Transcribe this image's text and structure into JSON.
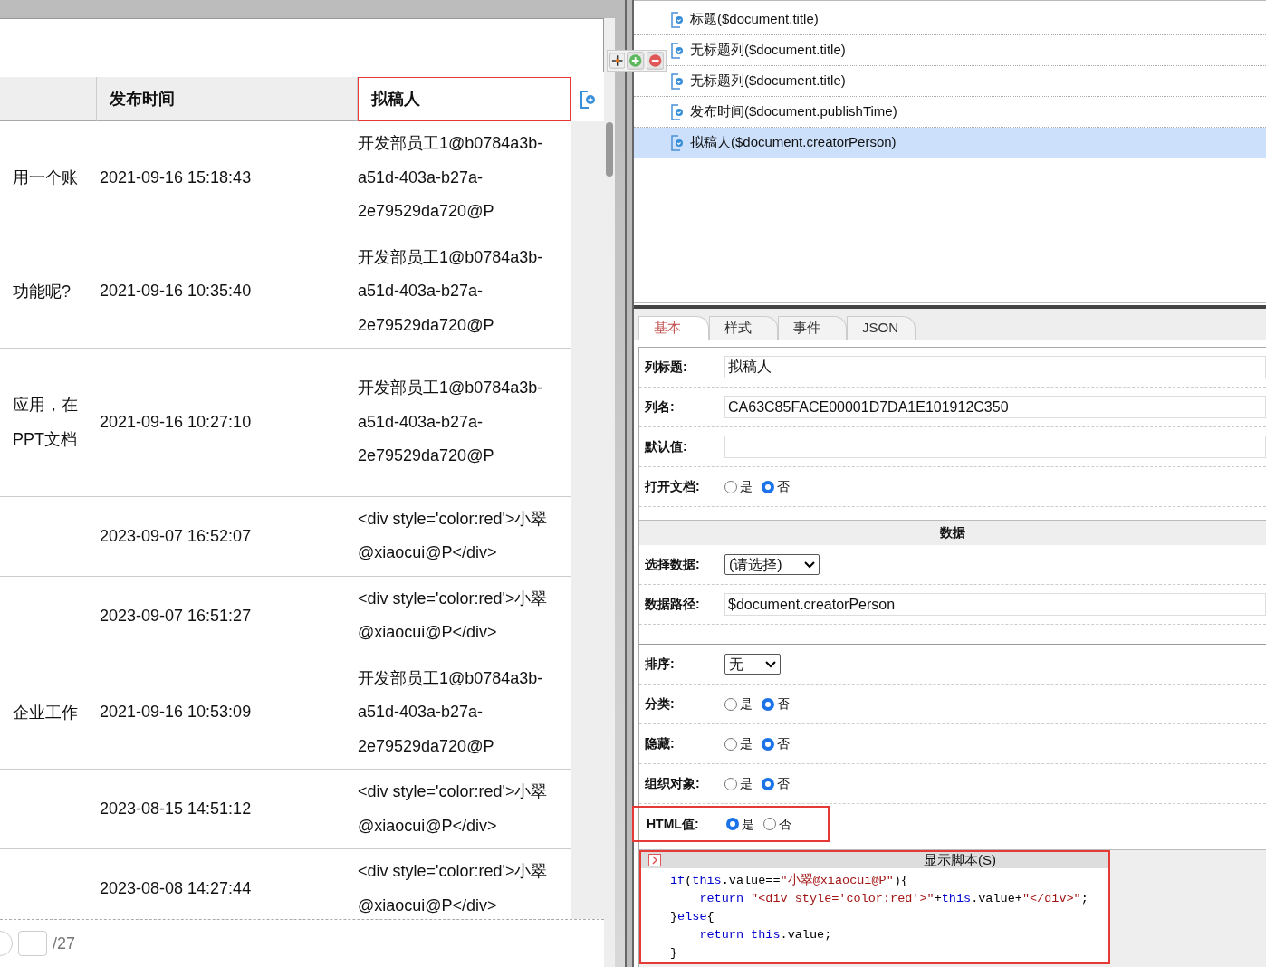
{
  "table": {
    "columns": [
      {
        "selected": false
      },
      {
        "label": "发布时间",
        "selected": false
      },
      {
        "label": "拟稿人",
        "selected": true
      }
    ],
    "rows": [
      {
        "column_1": "用一个账",
        "time": "2021-09-16 15:18:43",
        "author": "开发部员工1@b0784a3b-\na51d-403a-b27a-\n2e79529da720@P"
      },
      {
        "column_1": "功能呢?",
        "time": "2021-09-16 10:35:40",
        "author": "开发部员工1@b0784a3b-\na51d-403a-b27a-\n2e79529da720@P"
      },
      {
        "column_1": "应用，在\nPPT文档",
        "time": "2021-09-16 10:27:10",
        "author": "开发部员工1@b0784a3b-\na51d-403a-b27a-\n2e79529da720@P"
      },
      {
        "time": "2023-09-07 16:52:07",
        "author": "<div style='color:red'>小翠\n@xiaocui@P</div>"
      },
      {
        "time": "2023-09-07 16:51:27",
        "author": "<div style='color:red'>小翠\n@xiaocui@P</div>"
      },
      {
        "column_1": "企业工作",
        "time": "2021-09-16 10:53:09",
        "author": "开发部员工1@b0784a3b-\na51d-403a-b27a-\n2e79529da720@P"
      },
      {
        "time": "2023-08-15 14:51:12",
        "author": "<div style='color:red'>小翠\n@xiaocui@P</div>"
      },
      {
        "time": "2023-08-08 14:27:44",
        "author": "<div style='color:red'>小翠\n@xiaocui@P</div>"
      }
    ]
  },
  "pagination": {
    "total": "/27"
  },
  "fields": [
    {
      "label": "标题($document.title)",
      "selected": false
    },
    {
      "label": "无标题列($document.title)",
      "selected": false
    },
    {
      "label": "无标题列($document.title)",
      "selected": false
    },
    {
      "label": "发布时间($document.publishTime)",
      "selected": false
    },
    {
      "label": "拟稿人($document.creatorPerson)",
      "selected": true
    }
  ],
  "tabs": [
    {
      "label": "基本",
      "selected": true
    },
    {
      "label": "样式",
      "selected": false
    },
    {
      "label": "事件",
      "selected": false
    },
    {
      "label": "JSON",
      "selected": false
    }
  ],
  "form": [
    {
      "kind": "text",
      "label": "列标题:",
      "value": "拟稿人"
    },
    {
      "kind": "text",
      "label": "列名:",
      "value": "CA63C85FACE00001D7DA1E101912C350"
    },
    {
      "kind": "text",
      "label": "默认值:"
    },
    {
      "kind": "radio",
      "label": "打开文档:",
      "options": [
        {
          "label": "是",
          "selected": false
        },
        {
          "label": "否",
          "selected": true
        }
      ]
    },
    {
      "kind": "section",
      "label": "数据"
    },
    {
      "kind": "select",
      "label": "选择数据:",
      "value": "(请选择)"
    },
    {
      "kind": "text",
      "label": "数据路径:",
      "value": "$document.creatorPerson"
    },
    {
      "kind": "spacer"
    },
    {
      "kind": "select",
      "label": "排序:",
      "value": "无"
    },
    {
      "kind": "radio",
      "label": "分类:",
      "options": [
        {
          "label": "是",
          "selected": false
        },
        {
          "label": "否",
          "selected": true
        }
      ]
    },
    {
      "kind": "radio",
      "label": "隐藏:",
      "options": [
        {
          "label": "是",
          "selected": false
        },
        {
          "label": "否",
          "selected": true
        }
      ]
    },
    {
      "kind": "radio",
      "label": "组织对象:",
      "options": [
        {
          "label": "是",
          "selected": false
        },
        {
          "label": "否",
          "selected": true
        }
      ]
    },
    {
      "kind": "radio",
      "label": "HTML值:",
      "highlighted": true,
      "options": [
        {
          "label": "是",
          "selected": true
        },
        {
          "label": "否",
          "selected": false
        }
      ]
    }
  ],
  "script": {
    "title": "显示脚本(S)",
    "highlighted": true,
    "lines": [
      [
        {
          "kind": "keyword",
          "text": "if"
        },
        {
          "kind": "plain",
          "text": "("
        },
        {
          "kind": "keyword",
          "text": "this"
        },
        {
          "kind": "plain",
          "text": ".value=="
        },
        {
          "kind": "string",
          "text": "\"小翠@xiaocui@P\""
        },
        {
          "kind": "plain",
          "text": "){"
        }
      ],
      [
        {
          "kind": "keyword",
          "text": "    return"
        },
        {
          "kind": "string",
          "text": " \"<div style='color:red'>\""
        },
        {
          "kind": "plain",
          "text": "+"
        },
        {
          "kind": "keyword",
          "text": "this"
        },
        {
          "kind": "plain",
          "text": ".value+"
        },
        {
          "kind": "string",
          "text": "\"</div>\""
        },
        {
          "kind": "plain",
          "text": ";"
        }
      ],
      [
        {
          "kind": "plain",
          "text": "}"
        },
        {
          "kind": "keyword",
          "text": "else"
        },
        {
          "kind": "plain",
          "text": "{"
        }
      ],
      [
        {
          "kind": "keyword",
          "text": "    return"
        },
        {
          "kind": "keyword",
          "text": " this"
        },
        {
          "kind": "plain",
          "text": ".value;"
        }
      ],
      [
        {
          "kind": "plain",
          "text": "}"
        }
      ]
    ]
  }
}
